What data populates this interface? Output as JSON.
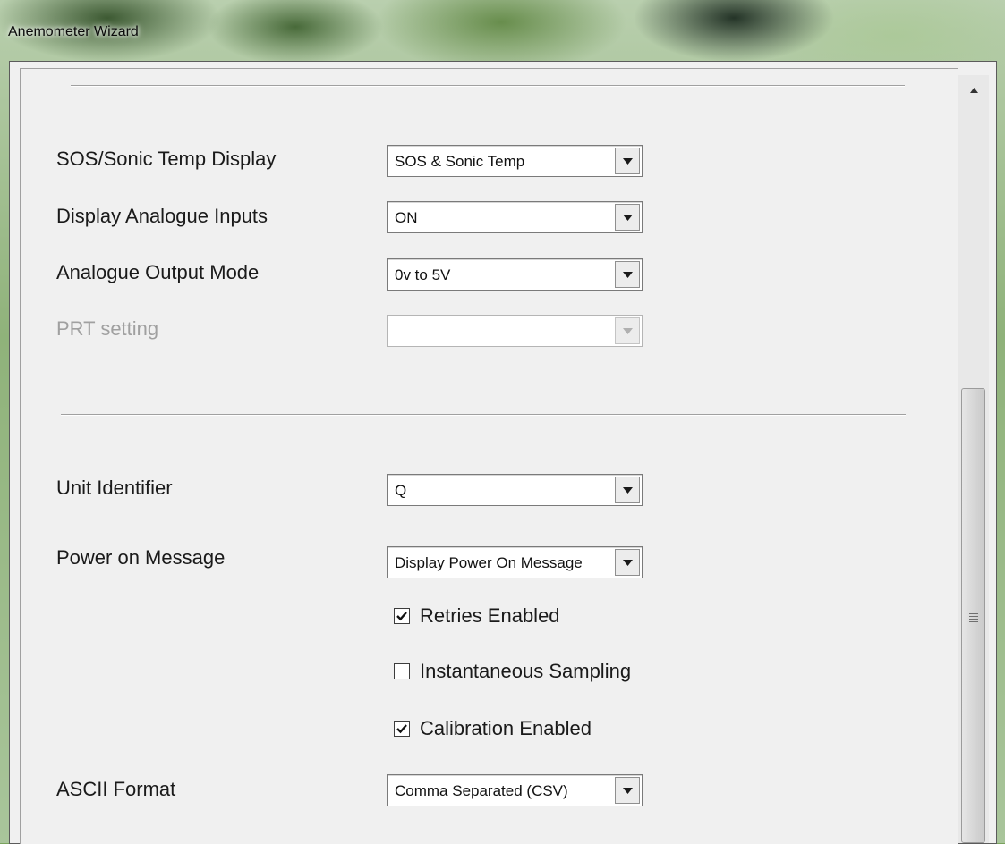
{
  "window": {
    "title": "Anemometer Wizard"
  },
  "display_section": {
    "sos_sonic_temp_display": {
      "label": "SOS/Sonic Temp Display",
      "value": "SOS & Sonic Temp"
    },
    "display_analogue_inputs": {
      "label": "Display Analogue Inputs",
      "value": "ON"
    },
    "analogue_output_mode": {
      "label": "Analogue Output  Mode",
      "value": "0v to 5V"
    },
    "prt_setting": {
      "label": "PRT setting",
      "value": "",
      "disabled": true
    }
  },
  "unit_section": {
    "unit_identifier": {
      "label": "Unit Identifier",
      "value": "Q"
    },
    "power_on_message": {
      "label": "Power on Message",
      "value": "Display Power On Message"
    },
    "checkboxes": [
      {
        "label": "Retries Enabled",
        "checked": true
      },
      {
        "label": "Instantaneous Sampling",
        "checked": false
      },
      {
        "label": "Calibration Enabled",
        "checked": true
      }
    ],
    "ascii_format": {
      "label": "ASCII Format",
      "value": "Comma Separated (CSV)"
    }
  },
  "icons": {
    "dropdown": "chevron-down-icon",
    "scroll_up": "scroll-up-arrow-icon",
    "scroll_grip": "scroll-grip-icon",
    "check": "checkmark-icon"
  },
  "colors": {
    "client_bg": "#f0f0f0",
    "disabled_text": "#a0a0a0"
  }
}
